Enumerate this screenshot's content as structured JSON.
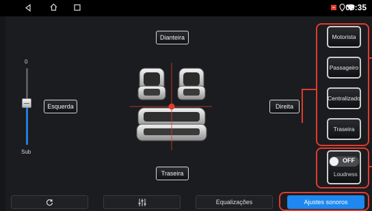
{
  "status_bar": {
    "time": "09:35",
    "nav_icons": [
      "back-icon",
      "home-icon",
      "recents-icon"
    ],
    "status_icons": [
      "sound-settings-icon",
      "location-icon",
      "wifi-icon"
    ]
  },
  "balance": {
    "front_label": "Dianteira",
    "rear_label": "Traseira",
    "left_label": "Esquerda",
    "right_label": "Direita"
  },
  "subwoofer": {
    "label": "Sub",
    "value": "0",
    "level_fraction": 0.55
  },
  "seat_presets": [
    {
      "key": "driver",
      "label": "Motorista"
    },
    {
      "key": "passenger",
      "label": "Passageiro"
    },
    {
      "key": "center",
      "label": "Centralizado"
    },
    {
      "key": "rear",
      "label": "Traseira"
    }
  ],
  "loudness": {
    "label": "Loudness",
    "state": "OFF"
  },
  "bottom_bar": {
    "reset_icon": "reset-icon",
    "eq_icon": "equalizer-sliders-icon",
    "equalizations_label": "Equalizações",
    "sound_settings_label": "Ajustes sonoros"
  },
  "colors": {
    "accent": "#1e88f0",
    "highlight": "#e23b2e",
    "background": "#1b1c1f"
  }
}
